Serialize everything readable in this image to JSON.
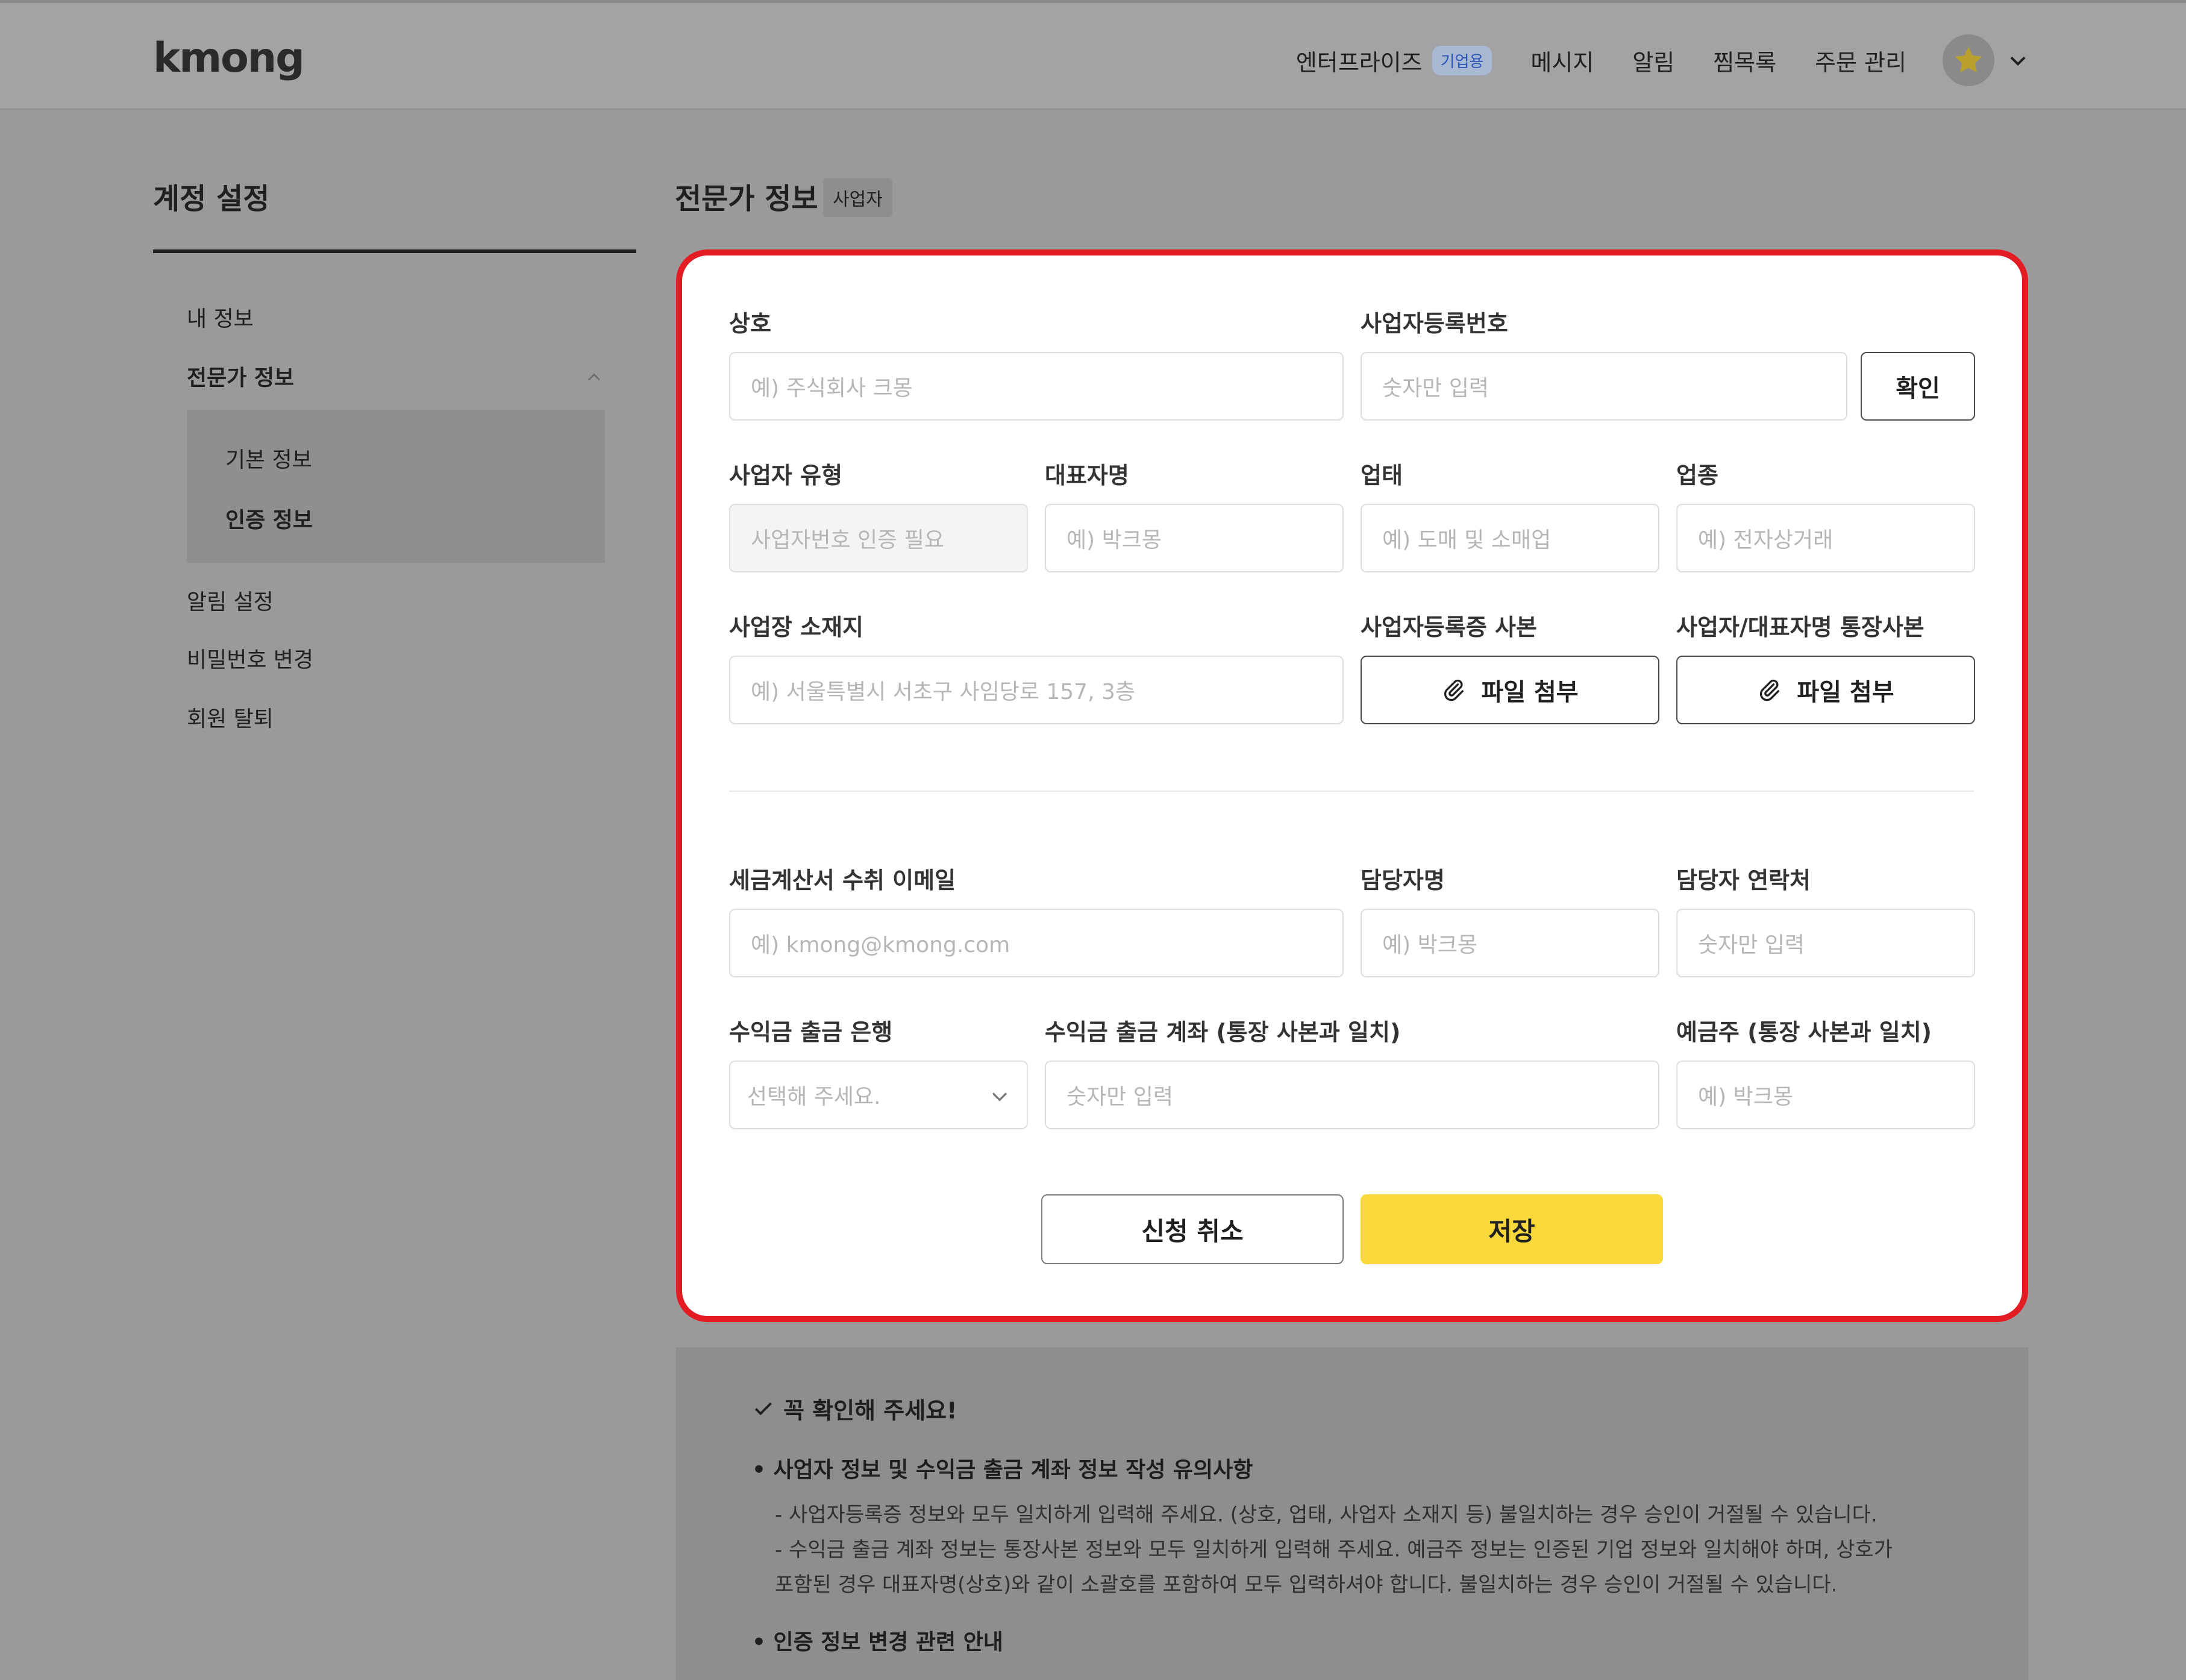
{
  "header": {
    "logo": "kmong",
    "nav": {
      "enterprise": "엔터프라이즈",
      "enterprise_badge": "기업용",
      "messages": "메시지",
      "alerts": "알림",
      "wishlist": "찜목록",
      "orders": "주문 관리"
    },
    "avatar_icon": "star-icon"
  },
  "sidebar": {
    "title": "계정 설정",
    "items": [
      "내 정보",
      "전문가 정보",
      "알림 설정",
      "비밀번호 변경",
      "회원 탈퇴"
    ],
    "subitems": [
      "기본 정보",
      "인증 정보"
    ]
  },
  "section": {
    "title": "전문가 정보",
    "badge": "사업자"
  },
  "form": {
    "company_name": {
      "label": "상호",
      "placeholder": "예) 주식회사 크몽"
    },
    "biz_reg_no": {
      "label": "사업자등록번호",
      "placeholder": "숫자만 입력"
    },
    "confirm_button": "확인",
    "biz_type": {
      "label": "사업자 유형",
      "placeholder": "사업자번호 인증 필요"
    },
    "ceo_name": {
      "label": "대표자명",
      "placeholder": "예) 박크몽"
    },
    "business_category": {
      "label": "업태",
      "placeholder": "예) 도매 및 소매업"
    },
    "business_item": {
      "label": "업종",
      "placeholder": "예) 전자상거래"
    },
    "address": {
      "label": "사업장 소재지",
      "placeholder": "예) 서울특별시 서초구 사임당로 157, 3층"
    },
    "biz_reg_copy": {
      "label": "사업자등록증 사본",
      "button": "파일 첨부"
    },
    "bankbook_copy": {
      "label": "사업자/대표자명 통장사본",
      "button": "파일 첨부"
    },
    "tax_email": {
      "label": "세금계산서 수취 이메일",
      "placeholder": "예) kmong@kmong.com"
    },
    "manager_name": {
      "label": "담당자명",
      "placeholder": "예) 박크몽"
    },
    "manager_phone": {
      "label": "담당자 연락처",
      "placeholder": "숫자만 입력"
    },
    "bank": {
      "label": "수익금 출금 은행",
      "placeholder": "선택해 주세요."
    },
    "account": {
      "label": "수익금 출금 계좌 (통장 사본과 일치)",
      "placeholder": "숫자만 입력"
    },
    "holder": {
      "label": "예금주 (통장 사본과 일치)",
      "placeholder": "예) 박크몽"
    },
    "cancel_button": "신청 취소",
    "save_button": "저장"
  },
  "notice": {
    "title": "꼭 확인해 주세요!",
    "section1": "• 사업자 정보 및 수익금 출금 계좌 정보 작성 유의사항",
    "lines": [
      "- 사업자등록증 정보와 모두 일치하게 입력해 주세요. (상호, 업태, 사업자 소재지 등) 불일치하는 경우 승인이 거절될 수 있습니다.",
      "- 수익금 출금 계좌 정보는 통장사본 정보와 모두 일치하게 입력해 주세요. 예금주 정보는 인증된 기업 정보와 일치해야 하며, 상호가",
      "포함된 경우 대표자명(상호)와 같이 소괄호를 포함하여 모두 입력하셔야 합니다. 불일치하는 경우 승인이 거절될 수 있습니다."
    ],
    "section2": "• 인증 정보 변경 관련 안내"
  },
  "colors": {
    "highlight_border": "#e31b22",
    "save_button": "#f8d83a",
    "enterprise_badge_text": "#2c55b8"
  }
}
